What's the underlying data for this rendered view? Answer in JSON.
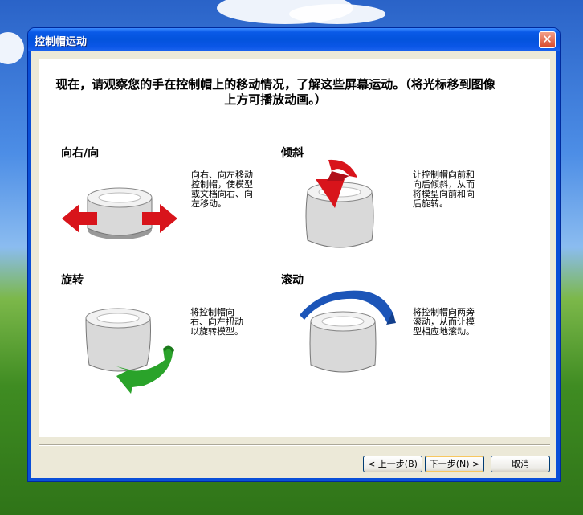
{
  "window": {
    "title": "控制帽运动"
  },
  "instruction": "现在，请观察您的手在控制帽上的移动情况，了解这些屏幕运动。（将光标移到图像上方可播放动画。）",
  "sections": [
    {
      "title": "向右/向",
      "description": [
        "向右、向左移动",
        "控制帽，使模型",
        "或文档向右、向",
        "左移动。"
      ],
      "icon": "left-right-arrows-icon"
    },
    {
      "title": "倾斜",
      "description": [
        "让控制帽向前和",
        "向后倾斜，从而",
        "将模型向前和向",
        "后旋转。"
      ],
      "icon": "tilt-arrow-icon"
    },
    {
      "title": "旋转",
      "description": [
        "将控制帽向",
        "右、向左扭动",
        "以旋转模型。"
      ],
      "icon": "rotate-arrow-icon"
    },
    {
      "title": "滚动",
      "description": [
        "将控制帽向两旁",
        "滚动，从而让模",
        "型相应地滚动。"
      ],
      "icon": "roll-arc-icon"
    }
  ],
  "buttons": {
    "back": "< 上一步(B)",
    "next": "下一步(N) >",
    "cancel": "取消"
  },
  "colors": {
    "red_arrow": "#d8141b",
    "green_arrow": "#2aa32a",
    "blue_arc": "#1c55b8",
    "titlebar": "#0a56e6"
  }
}
